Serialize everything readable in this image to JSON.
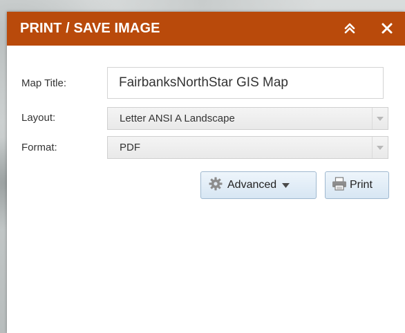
{
  "panel": {
    "title": "PRINT / SAVE IMAGE",
    "collapse_icon": "double-chevron-up-icon",
    "close_icon": "close-icon"
  },
  "form": {
    "map_title_label": "Map Title:",
    "map_title_value": "FairbanksNorthStar GIS Map",
    "layout_label": "Layout:",
    "layout_value": "Letter ANSI A Landscape",
    "format_label": "Format:",
    "format_value": "PDF"
  },
  "buttons": {
    "advanced_label": "Advanced",
    "advanced_icon": "gear-icon",
    "print_label": "Print",
    "print_icon": "printer-icon"
  },
  "colors": {
    "header": "#b94a0b",
    "header_text": "#ffffff",
    "button_border": "#9fb8cf"
  }
}
